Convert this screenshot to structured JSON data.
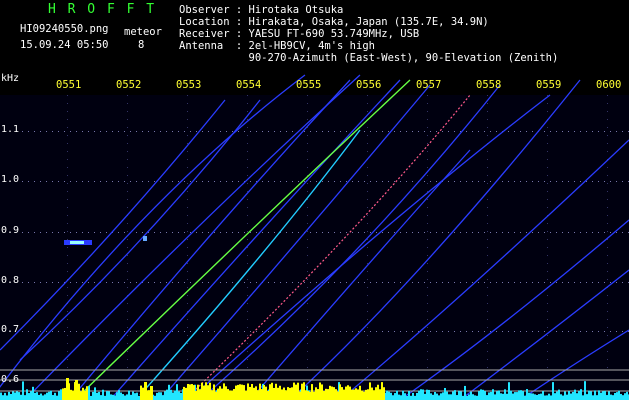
{
  "header": {
    "brand": "H R O F F T",
    "filename": "HI09240550.png",
    "datetime": "15.09.24 05:50",
    "type_label": "meteor",
    "count": "8"
  },
  "station": {
    "observer": "Observer : Hirotaka Otsuka",
    "location": "Location : Hirakata, Osaka, Japan (135.7E, 34.9N)",
    "receiver": "Receiver : YAESU FT-690 53.749MHz, USB",
    "antenna": "Antenna  : 2el-HB9CV, 4m's high",
    "antenna2": "           90-270-Azimuth (East-West), 90-Elevation (Zenith)"
  },
  "axis": {
    "unit": "kHz",
    "y_ticks": [
      "1.1",
      "1.0",
      "0.9",
      "0.8",
      "0.7",
      "0.6"
    ],
    "x_ticks": [
      "0551",
      "0552",
      "0553",
      "0554",
      "0555",
      "0556",
      "0557",
      "0558",
      "0559",
      "0600"
    ]
  },
  "colors": {
    "label_green": "#33ff33",
    "text_white": "#ffffff",
    "time_yellow": "#ffff33",
    "trace_blue": "#2a3cff",
    "trace_green": "#66ff44",
    "noise_cyan": "#22e6ff",
    "burst_yellow": "#ffff00"
  }
}
